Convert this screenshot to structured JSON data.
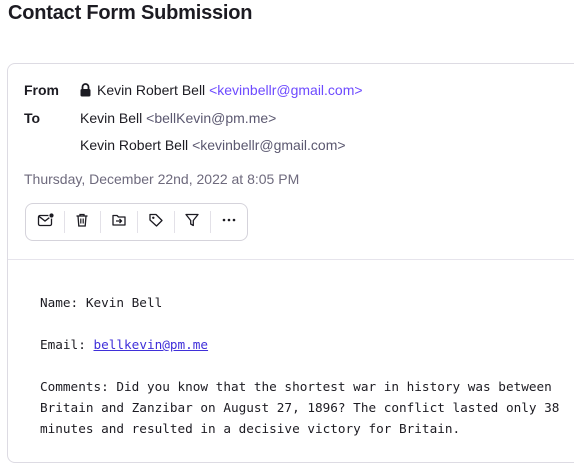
{
  "page": {
    "title": "Contact Form Submission"
  },
  "header": {
    "from_label": "From",
    "to_label": "To",
    "from": {
      "name": "Kevin Robert Bell",
      "email": "<kevinbellr@gmail.com>"
    },
    "to": [
      {
        "name": "Kevin Bell",
        "email": "<bellKevin@pm.me>"
      },
      {
        "name": "Kevin Robert Bell",
        "email": "<kevinbellr@gmail.com>"
      }
    ],
    "date": "Thursday, December 22nd, 2022 at 8:05 PM"
  },
  "toolbar": {
    "icons": [
      "mark-unread-icon",
      "trash-icon",
      "move-to-folder-icon",
      "label-icon",
      "filter-icon",
      "more-icon"
    ]
  },
  "message": {
    "name_line": "Name: Kevin Bell",
    "email_prefix": "Email: ",
    "email_link": "bellkevin@pm.me",
    "comments_line1": "Comments: Did you know that the shortest war in history was between",
    "comments_line2": "Britain and Zanzibar on August 27, 1896? The conflict lasted only 38",
    "comments_line3": "minutes and resulted in a decisive victory for Britain."
  },
  "colors": {
    "accent": "#6d4aff",
    "link": "#3f2fd9",
    "muted": "#6e6a7d",
    "border": "#dddbe3"
  }
}
